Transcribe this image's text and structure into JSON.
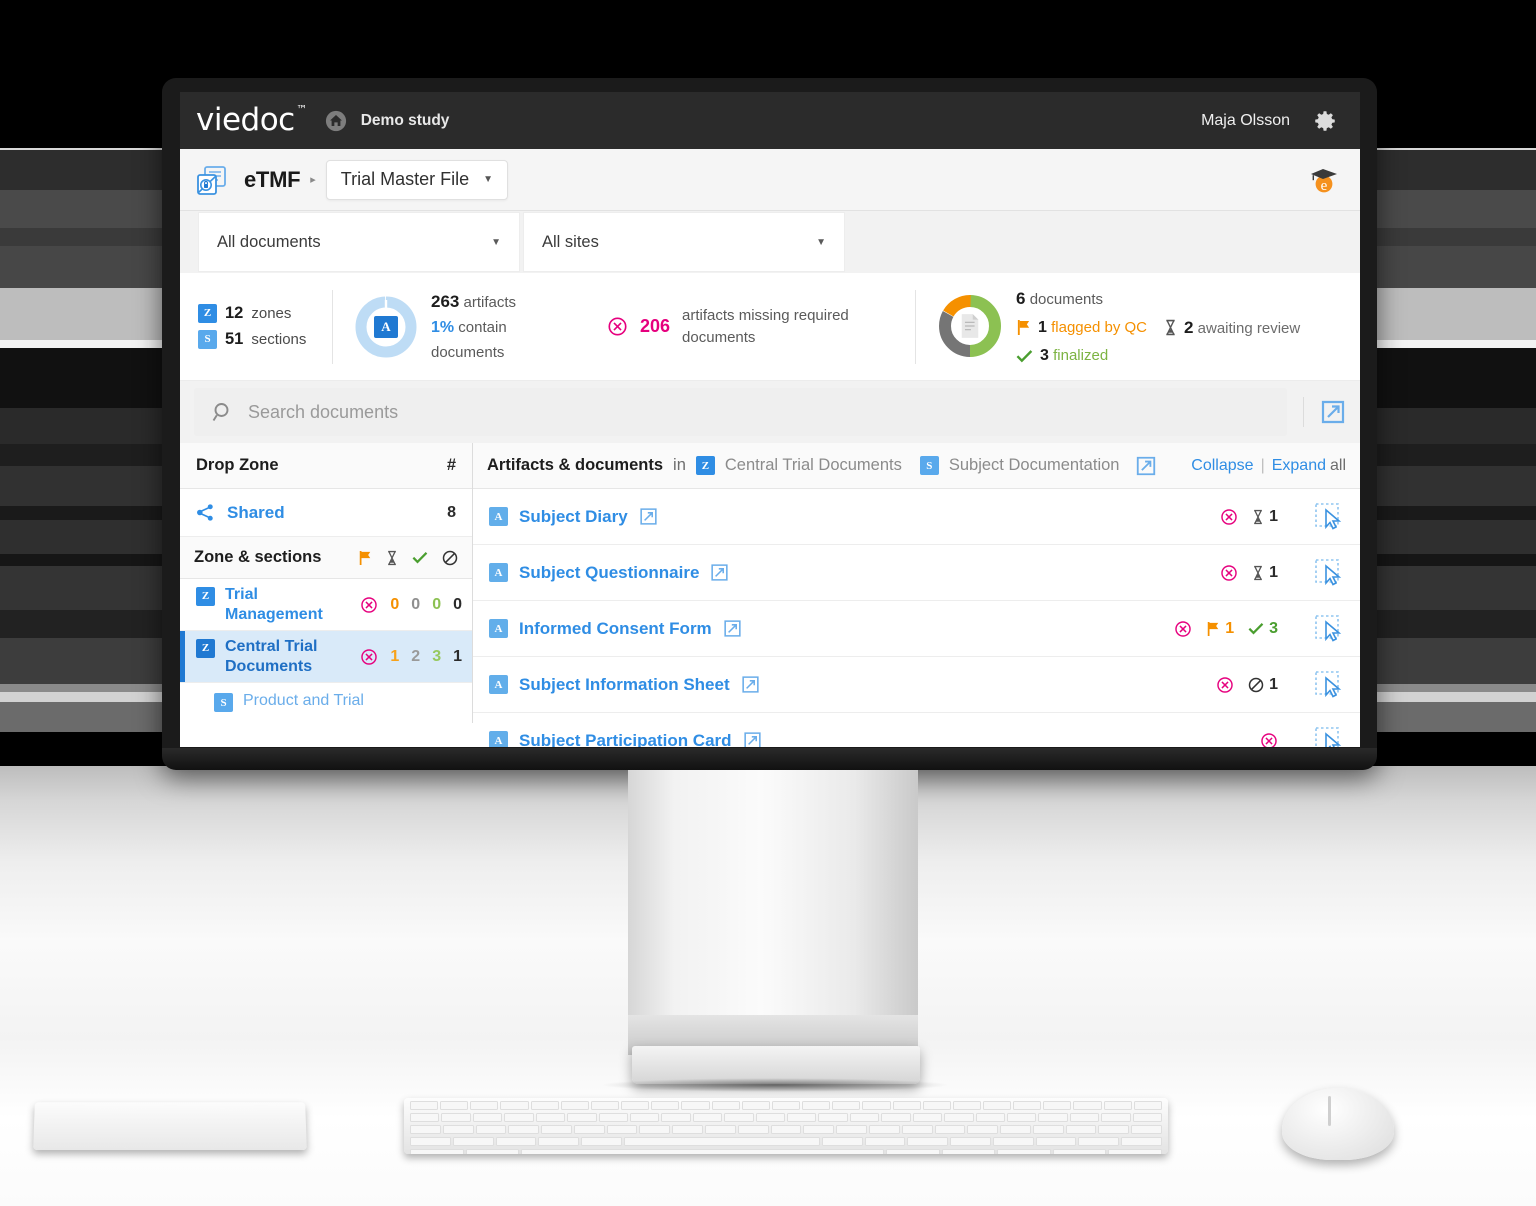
{
  "header": {
    "logo": "viedoc",
    "logo_tm": "™",
    "home_icon": "home-icon",
    "study_name": "Demo study",
    "user_name": "Maja Olsson",
    "gear_icon": "gear-icon"
  },
  "module_bar": {
    "module_icon": "etmf-folder-lock-icon",
    "module_title": "eTMF",
    "caret": "▸",
    "file_selector": "Trial Master File",
    "file_selector_caret": "▼",
    "elearning_icon": "elearning-graduation-cap-icon"
  },
  "filters": {
    "documents_filter": "All documents",
    "sites_filter": "All sites",
    "caret": "▼"
  },
  "stats": {
    "zones_count": "12",
    "zones_label": "zones",
    "sections_count": "51",
    "sections_label": "sections",
    "zone_badge": "Z",
    "section_badge": "S",
    "artifact_badge": "A",
    "artifacts_count": "263",
    "artifacts_label": "artifacts",
    "artifacts_percent": "1%",
    "artifacts_percent_label": "contain documents",
    "missing_count": "206",
    "missing_label": "artifacts missing required documents",
    "documents_count": "6",
    "documents_label": "documents",
    "flagged_count": "1",
    "flagged_label": "flagged by QC",
    "awaiting_count": "2",
    "awaiting_label": "awaiting review",
    "finalized_count": "3",
    "finalized_label": "finalized"
  },
  "search": {
    "placeholder": "Search documents",
    "search_icon": "search-icon",
    "popout_icon": "pop-out-icon"
  },
  "left_pane": {
    "title": "Drop Zone",
    "hash": "#",
    "shared_label": "Shared",
    "shared_count": "8",
    "share_icon": "share-icon",
    "zone_sections_title": "Zone & sections",
    "status_icons": [
      "flag-icon",
      "hourglass-icon",
      "check-icon",
      "blocked-icon"
    ],
    "zones": [
      {
        "badge": "Z",
        "label": "Trial Management",
        "missing_icon": "missing-required-icon",
        "counts": [
          "0",
          "0",
          "0",
          "0"
        ],
        "active": false,
        "type": "zone"
      },
      {
        "badge": "Z",
        "label": "Central Trial Documents",
        "missing_icon": "missing-required-icon",
        "counts": [
          "1",
          "2",
          "3",
          "1"
        ],
        "active": true,
        "type": "zone"
      },
      {
        "badge": "S",
        "label": "Product and Trial",
        "counts": [],
        "active": false,
        "type": "section"
      }
    ]
  },
  "right_pane": {
    "title": "Artifacts & documents",
    "in_word": "in",
    "zone_badge": "Z",
    "zone_name": "Central Trial Documents",
    "section_badge": "S",
    "section_name": "Subject Documentation",
    "popout_icon": "pop-out-icon",
    "collapse_label": "Collapse",
    "separator": "|",
    "expand_label": "Expand",
    "all_label": "all",
    "artifacts": [
      {
        "badge": "A",
        "name": "Subject Diary",
        "link_icon": "pop-out-icon",
        "missing_icon": "missing-required-icon",
        "stats": [
          {
            "icon": "hourglass-icon",
            "value": "1",
            "kind": "k"
          }
        ],
        "drop_icon": "drop-target-cursor-icon"
      },
      {
        "badge": "A",
        "name": "Subject Questionnaire",
        "link_icon": "pop-out-icon",
        "missing_icon": "missing-required-icon",
        "stats": [
          {
            "icon": "hourglass-icon",
            "value": "1",
            "kind": "k"
          }
        ],
        "drop_icon": "drop-target-cursor-icon"
      },
      {
        "badge": "A",
        "name": "Informed Consent Form",
        "link_icon": "pop-out-icon",
        "missing_icon": "missing-required-icon",
        "stats": [
          {
            "icon": "flag-icon",
            "value": "1",
            "kind": "o"
          },
          {
            "icon": "check-icon",
            "value": "3",
            "kind": "g"
          }
        ],
        "drop_icon": "drop-target-cursor-icon"
      },
      {
        "badge": "A",
        "name": "Subject Information Sheet",
        "link_icon": "pop-out-icon",
        "missing_icon": "missing-required-icon",
        "stats": [
          {
            "icon": "blocked-icon",
            "value": "1",
            "kind": "k"
          }
        ],
        "drop_icon": "drop-target-cursor-icon"
      },
      {
        "badge": "A",
        "name": "Subject Participation Card",
        "link_icon": "pop-out-icon",
        "missing_icon": "missing-required-icon",
        "stats": [],
        "drop_icon": "drop-target-cursor-icon"
      }
    ]
  },
  "colors": {
    "brand_blue": "#2f8de4",
    "dark_blue": "#2079d2",
    "magenta": "#e6007e",
    "orange": "#f59000",
    "green": "#7cb342",
    "gray": "#6c6c6c",
    "header_dark": "#2b2b2b"
  },
  "donut": {
    "orange_pct": 17,
    "green_pct": 50,
    "gray_pct": 33
  }
}
